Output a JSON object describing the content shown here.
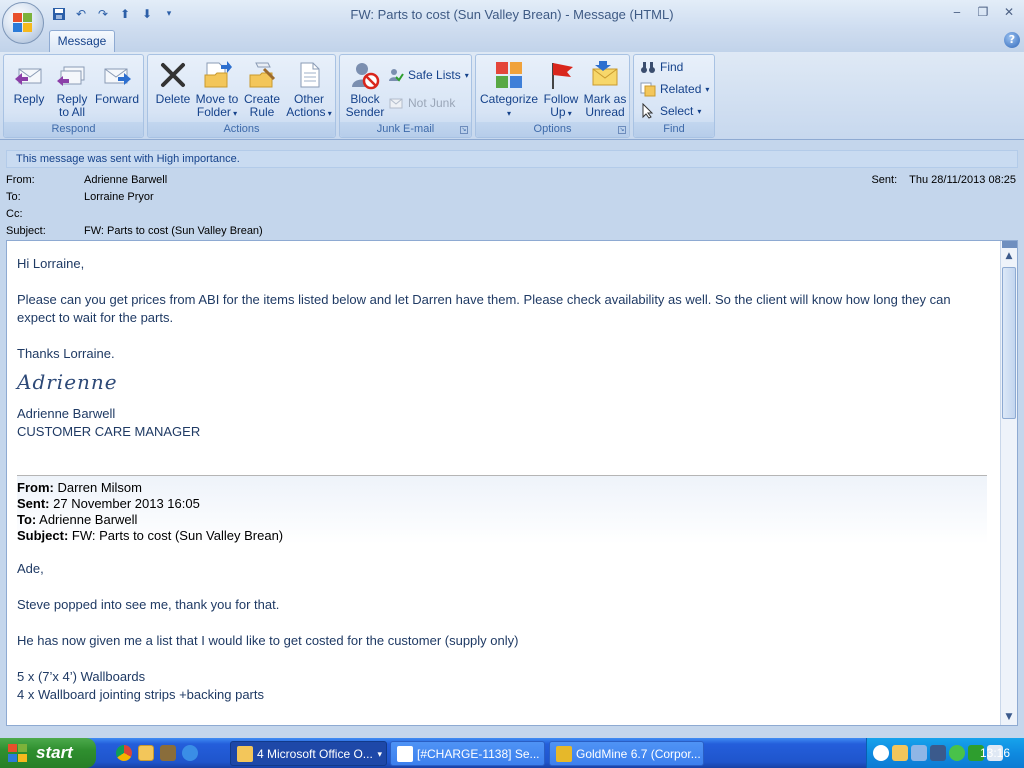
{
  "window": {
    "title": "FW: Parts to cost (Sun Valley Brean) - Message (HTML)",
    "minimize": "‒",
    "restore": "❐",
    "close": "✕"
  },
  "ribbon": {
    "tab": "Message",
    "help": "?",
    "groups": {
      "respond": "Respond",
      "actions": "Actions",
      "junk": "Junk E-mail",
      "options": "Options",
      "find": "Find"
    },
    "buttons": {
      "reply": "Reply",
      "reply_all_1": "Reply",
      "reply_all_2": "to All",
      "forward": "Forward",
      "delete": "Delete",
      "move_1": "Move to",
      "move_2": "Folder",
      "create_1": "Create",
      "create_2": "Rule",
      "other_1": "Other",
      "other_2": "Actions",
      "block_1": "Block",
      "block_2": "Sender",
      "safe_lists": "Safe Lists",
      "not_junk": "Not Junk",
      "categorize": "Categorize",
      "follow_1": "Follow",
      "follow_2": "Up",
      "mark_1": "Mark as",
      "mark_2": "Unread",
      "find": "Find",
      "related": "Related",
      "select": "Select"
    }
  },
  "info_bar": "This message was sent with High importance.",
  "header": {
    "from_label": "From:",
    "from": "Adrienne Barwell",
    "to_label": "To:",
    "to": "Lorraine Pryor",
    "cc_label": "Cc:",
    "cc": "",
    "subject_label": "Subject:",
    "subject": "FW: Parts to cost (Sun Valley Brean)",
    "sent_label": "Sent:",
    "sent": "Thu 28/11/2013 08:25"
  },
  "body": {
    "greeting": "Hi Lorraine,",
    "para1": "Please can you get prices from ABI for the items listed below and let Darren have them.    Please check availability as well.  So the client will know how long they can expect to wait for the parts.",
    "thanks": "Thanks Lorraine.",
    "signature_script": "Adrienne",
    "sig_name": "Adrienne Barwell",
    "sig_title": "CUSTOMER CARE MANAGER",
    "fwd": {
      "from_label": "From:",
      "from": "Darren Milsom",
      "sent_label": "Sent:",
      "sent": "27 November 2013 16:05",
      "to_label": "To:",
      "to": "Adrienne Barwell",
      "subject_label": "Subject:",
      "subject": "FW: Parts to cost (Sun Valley Brean)"
    },
    "fwd_greeting": "Ade,",
    "fwd_para1": "Steve popped into see me, thank you for that.",
    "fwd_para2": "He has now given me a list that I would like to get costed for the customer (supply only)",
    "items": [
      "5 x (7’x 4’) Wallboards",
      "4 x Wallboard jointing strips +backing parts"
    ]
  },
  "taskbar": {
    "start": "start",
    "tasks": [
      "4 Microsoft Office O...",
      "[#CHARGE-1138] Se...",
      "GoldMine 6.7 (Corpor..."
    ],
    "clock": "13:16"
  }
}
